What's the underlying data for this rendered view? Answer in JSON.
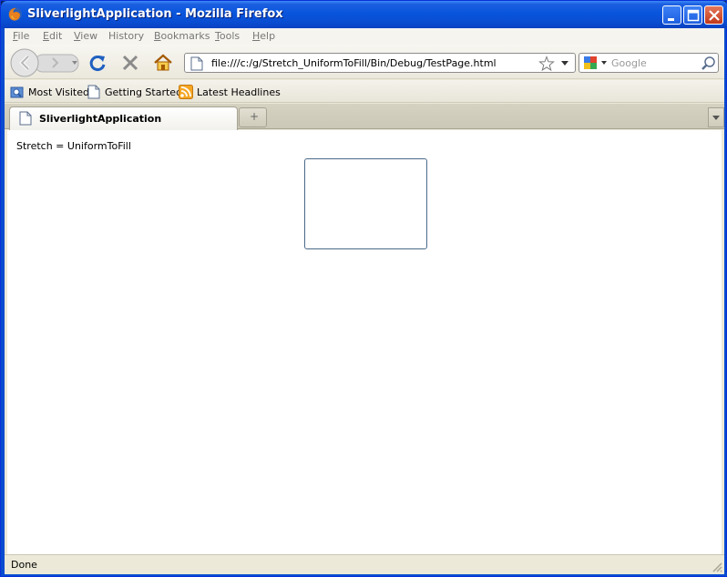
{
  "window": {
    "title": "SliverlightApplication - Mozilla Firefox",
    "icon": "firefox-icon"
  },
  "window_controls": {
    "minimize_icon": "minimize-icon",
    "maximize_icon": "maximize-icon",
    "close_icon": "close-icon"
  },
  "menu": {
    "items": [
      {
        "label": "File",
        "underline": "F",
        "rest": "ile"
      },
      {
        "label": "Edit",
        "underline": "E",
        "rest": "dit"
      },
      {
        "label": "View",
        "underline": "V",
        "rest": "iew"
      },
      {
        "label": "History",
        "underline": "",
        "rest": "History"
      },
      {
        "label": "Bookmarks",
        "underline": "B",
        "rest": "ookmarks"
      },
      {
        "label": "Tools",
        "underline": "T",
        "rest": "ools"
      },
      {
        "label": "Help",
        "underline": "H",
        "rest": "elp"
      }
    ]
  },
  "navbar": {
    "url": "file:///c:/g/Stretch_UniformToFill/Bin/Debug/TestPage.html",
    "search_placeholder": "Google",
    "icons": [
      "back-icon",
      "forward-icon",
      "reload-icon",
      "stop-icon",
      "home-icon",
      "bookmark-star-icon",
      "search-icon"
    ]
  },
  "bookmarks": {
    "items": [
      {
        "label": "Most Visited",
        "icon": "most-visited-icon"
      },
      {
        "label": "Getting Started",
        "icon": "page-icon"
      },
      {
        "label": "Latest Headlines",
        "icon": "rss-icon"
      }
    ]
  },
  "tabs": [
    {
      "label": "SliverlightApplication",
      "active": true
    }
  ],
  "content": {
    "stretch_label": "Stretch = UniformToFill"
  },
  "status": {
    "text": "Done"
  },
  "colors": {
    "titlebar": "#0855dd",
    "silverlight_border": "#4a6a8a"
  }
}
